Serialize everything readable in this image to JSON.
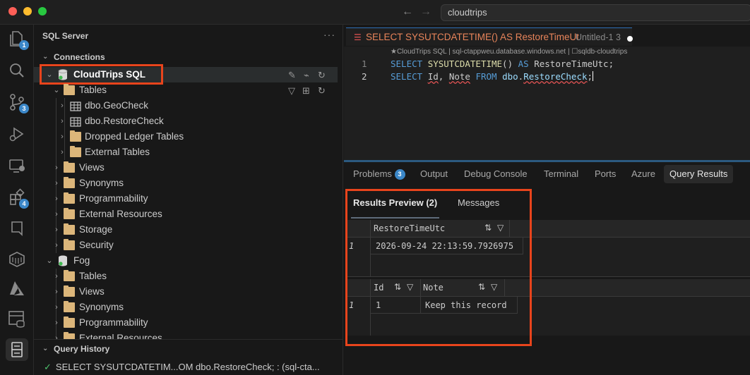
{
  "window": {
    "search_text": "cloudtrips"
  },
  "activity_bar": {
    "explorer_badge": "1",
    "source_control_badge": "3",
    "extensions_badge": "4"
  },
  "sidebar": {
    "title": "SQL Server",
    "more": "···",
    "connections_label": "Connections",
    "query_history_label": "Query History",
    "tree": {
      "conn1": "CloudTrips SQL",
      "tables": "Tables",
      "geocheck": "dbo.GeoCheck",
      "restorecheck": "dbo.RestoreCheck",
      "dropped": "Dropped Ledger Tables",
      "external_tables": "External Tables",
      "views": "Views",
      "synonyms": "Synonyms",
      "programmability": "Programmability",
      "external_resources": "External Resources",
      "storage": "Storage",
      "security": "Security",
      "conn2": "Fog",
      "fog_tables": "Tables",
      "fog_views": "Views",
      "fog_synonyms": "Synonyms",
      "fog_programmability": "Programmability",
      "fog_external_resources": "External Resources"
    },
    "query_history_item": "SELECT SYSUTCDATETIM...OM dbo.RestoreCheck; : (sql-cta..."
  },
  "editor": {
    "tab_title": "SELECT SYSUTCDATETIME() AS RestoreTimeUt",
    "tab_desc": "Untitled-1 3",
    "breadcrumb": "★CloudTrips SQL | sql-ctappweu.database.windows.net | ☐sqldb-cloudtrips",
    "line1_no": "1",
    "line2_no": "2"
  },
  "panel": {
    "tabs": {
      "problems": "Problems",
      "problems_count": "3",
      "output": "Output",
      "debug_console": "Debug Console",
      "terminal": "Terminal",
      "ports": "Ports",
      "azure": "Azure",
      "query_results": "Query Results"
    },
    "results_tabs": {
      "preview": "Results Preview (2)",
      "messages": "Messages"
    },
    "grid1": {
      "column": "RestoreTimeUtc",
      "row_num": "1",
      "value": "2026-09-24 22:13:59.7926975"
    },
    "grid2": {
      "col_id": "Id",
      "col_note": "Note",
      "row_num": "1",
      "id_value": "1",
      "note_value": "Keep this record"
    }
  }
}
